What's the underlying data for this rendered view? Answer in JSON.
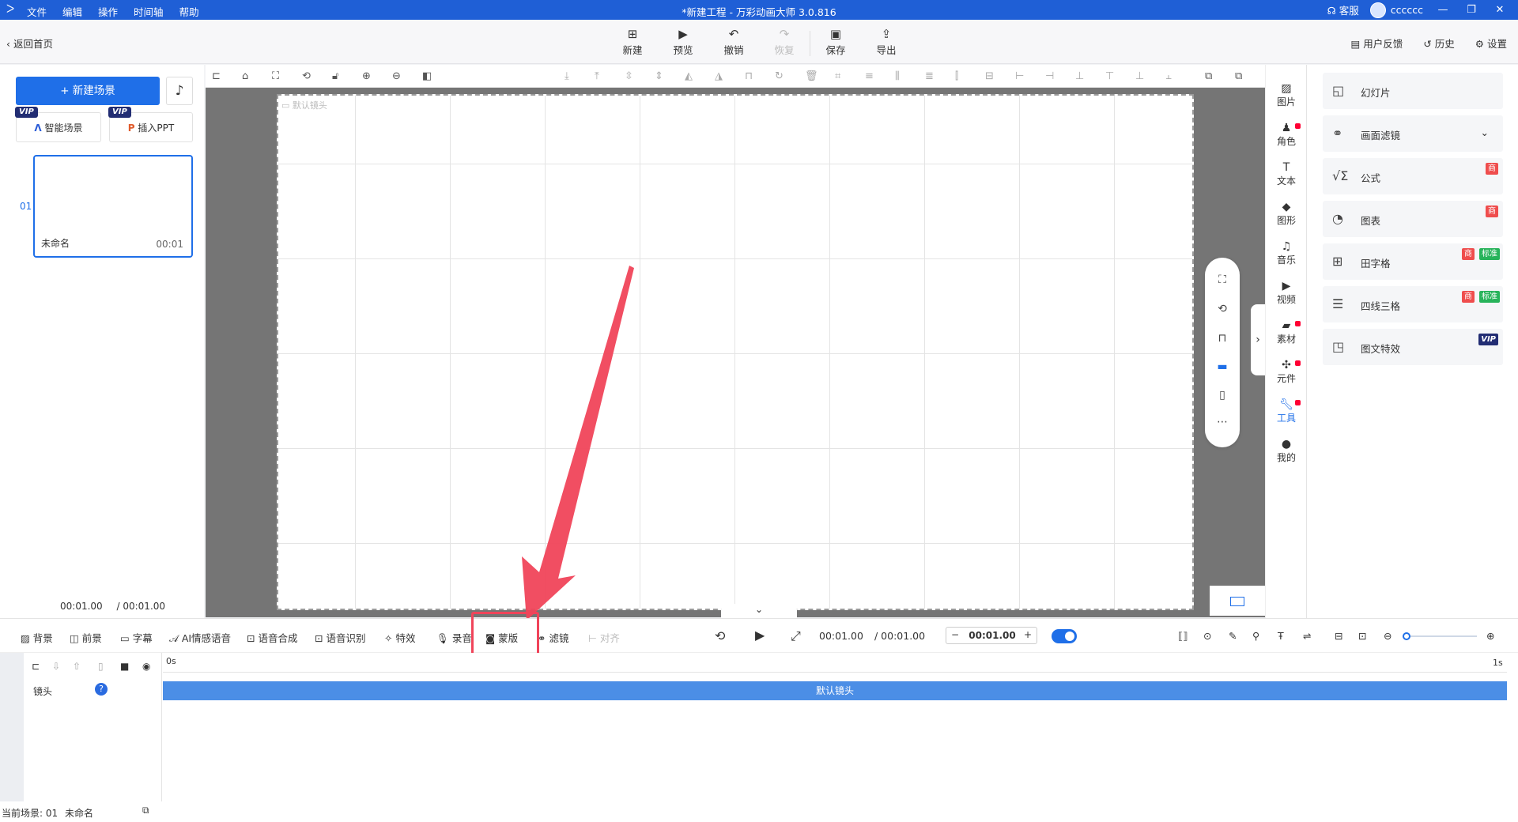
{
  "titlebar": {
    "menu": [
      "文件",
      "编辑",
      "操作",
      "时间轴",
      "帮助"
    ],
    "window_title": "*新建工程 - 万彩动画大师 3.0.816",
    "support": "客服",
    "username": "cccccc"
  },
  "toolbar": {
    "back_label": "返回首页",
    "new_label": "新建",
    "preview_label": "预览",
    "undo_label": "撤销",
    "redo_label": "恢复",
    "save_label": "保存",
    "export_label": "导出",
    "feedback_label": "用户反馈",
    "history_label": "历史",
    "settings_label": "设置"
  },
  "leftpanel": {
    "new_scene_label": "+ 新建场景",
    "smart_scene_label": "智能场景",
    "insert_ppt_label": "插入PPT",
    "vip_badge": "VIP",
    "scene_index": "01",
    "scene_name": "未命名",
    "scene_duration": "00:01",
    "current_time": "00:01.00",
    "total_time": "/ 00:01.00"
  },
  "stage": {
    "camera_label": "默认镜头"
  },
  "rightnav": {
    "items": [
      "图片",
      "角色",
      "文本",
      "图形",
      "音乐",
      "视频",
      "素材",
      "元件",
      "工具",
      "我的"
    ]
  },
  "rightpanel": {
    "items": [
      {
        "label": "幻灯片"
      },
      {
        "label": "画面滤镜"
      },
      {
        "label": "公式",
        "tag1": "商"
      },
      {
        "label": "图表",
        "tag1": "商"
      },
      {
        "label": "田字格",
        "tag1": "商",
        "tag2": "标准"
      },
      {
        "label": "四线三格",
        "tag1": "商",
        "tag2": "标准"
      },
      {
        "label": "图文特效",
        "tag1": "VIP"
      }
    ]
  },
  "bottombar": {
    "background": "背景",
    "foreground": "前景",
    "subtitle": "字幕",
    "ai_voice": "AI情感语音",
    "tts": "语音合成",
    "asr": "语音识别",
    "effects": "特效",
    "record": "录音",
    "mask": "蒙版",
    "filter": "滤镜",
    "align": "对齐",
    "current_time": "00:01.00",
    "total_time": "/ 00:01.00",
    "duration_value": "00:01.00"
  },
  "timeline": {
    "ruler_start": "0s",
    "ruler_end": "1s",
    "track_label": "镜头",
    "clip_label": "默认镜头",
    "status": "当前场景: 01",
    "status_name": "未命名"
  },
  "colors": {
    "accent": "#1f6fe8",
    "titlebar": "#1f5fd6",
    "highlight": "#f0445a"
  }
}
